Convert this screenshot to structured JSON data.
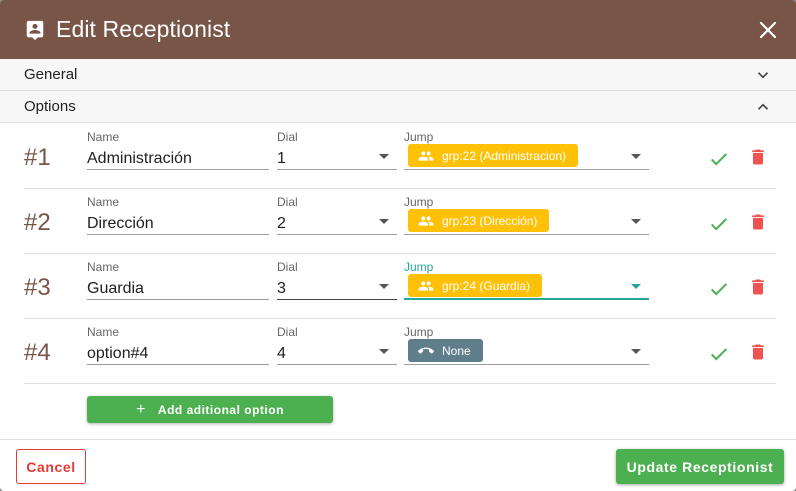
{
  "dialog": {
    "title": "Edit Receptionist",
    "title_icon": "contact-card-icon",
    "close_icon": "close-icon"
  },
  "sections": {
    "general": {
      "label": "General",
      "icon": "chevron-down-icon"
    },
    "options": {
      "label": "Options",
      "icon": "chevron-up-icon"
    }
  },
  "labels": {
    "name": "Name",
    "dial": "Dial",
    "jump": "Jump"
  },
  "options": [
    {
      "number": "#1",
      "name": "Administración",
      "dial": "1",
      "jump": "grp:22 (Administracion)",
      "jump_type": "group"
    },
    {
      "number": "#2",
      "name": "Dirección",
      "dial": "2",
      "jump": "grp:23 (Dirección)",
      "jump_type": "group"
    },
    {
      "number": "#3",
      "name": "Guardia",
      "dial": "3",
      "jump": "grp:24 (Guardia)",
      "jump_type": "group"
    },
    {
      "number": "#4",
      "name": "option#4",
      "dial": "4",
      "jump": "None",
      "jump_type": "none"
    }
  ],
  "add_option_label": "Add aditional option",
  "footer": {
    "cancel_label": "Cancel",
    "update_label": "Update Receptionist"
  },
  "colors": {
    "header": "#795548",
    "group_chip": "#ffc107",
    "none_chip": "#607d8b",
    "confirm": "#4caf50",
    "delete": "#ef5350",
    "focus": "#26a69a"
  }
}
